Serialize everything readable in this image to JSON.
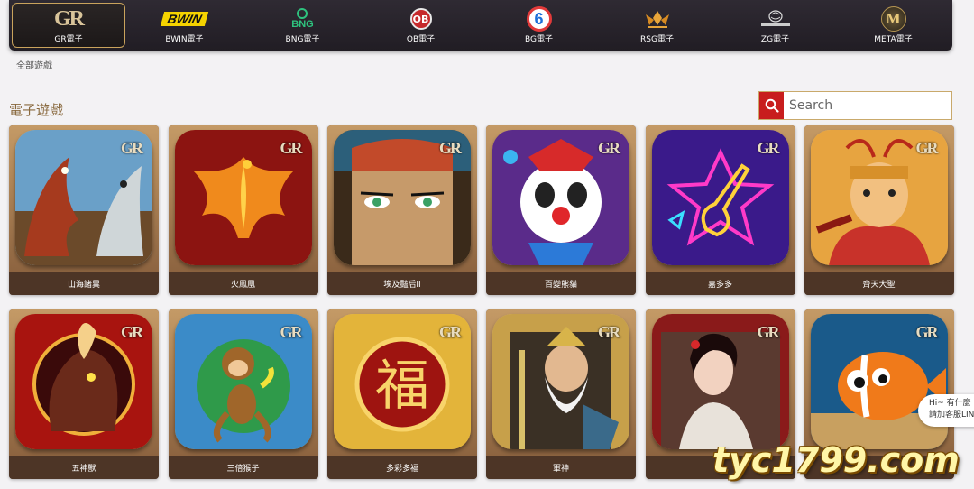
{
  "providers": [
    {
      "name": "GR電子",
      "icon": "gr-logo",
      "logo_text": "GR",
      "active": true
    },
    {
      "name": "BWIN電子",
      "icon": "bwin-logo",
      "logo_text": "BWIN"
    },
    {
      "name": "BNG電子",
      "icon": "bng-logo",
      "logo_text": "BNG"
    },
    {
      "name": "OB電子",
      "icon": "ob-logo",
      "logo_text": "OB"
    },
    {
      "name": "BG電子",
      "icon": "bg-logo",
      "logo_text": "6"
    },
    {
      "name": "RSG電子",
      "icon": "rsg-logo"
    },
    {
      "name": "ZG電子",
      "icon": "zg-logo"
    },
    {
      "name": "META電子",
      "icon": "meta-logo",
      "logo_text": "M"
    }
  ],
  "breadcrumb": "全部遊戲",
  "section_title": "電子遊戲",
  "search": {
    "placeholder": "Search",
    "value": ""
  },
  "games": [
    {
      "name": "山海諸異",
      "theme": "dragons"
    },
    {
      "name": "火鳳凰",
      "theme": "phoenix"
    },
    {
      "name": "埃及豔后II",
      "theme": "cleopatra"
    },
    {
      "name": "百變熊貓",
      "theme": "panda"
    },
    {
      "name": "嘉多多",
      "theme": "guitar"
    },
    {
      "name": "齊天大聖",
      "theme": "monkey-king"
    },
    {
      "name": "五神獸",
      "theme": "beast"
    },
    {
      "name": "三倍猴子",
      "theme": "monkey"
    },
    {
      "name": "多彩多福",
      "theme": "fortune"
    },
    {
      "name": "軍神",
      "theme": "warrior"
    },
    {
      "name": "",
      "theme": "lady"
    },
    {
      "name": "",
      "theme": "clownfish"
    }
  ],
  "tile_badge": "GR",
  "chat": {
    "line1": "Hi~ 有什麼",
    "line2": "請加客服LIN"
  },
  "watermark": "tyc1799.com",
  "colors": {
    "accent": "#c81d1d",
    "gold": "#c9a35c",
    "card": "#4d3526"
  }
}
